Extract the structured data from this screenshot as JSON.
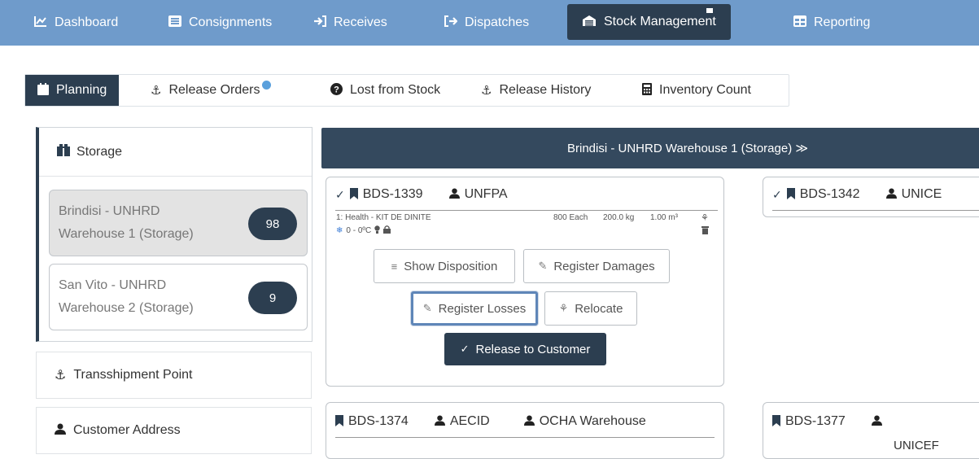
{
  "nav": {
    "items": [
      {
        "icon": "chart-line-icon",
        "glyph": "📈",
        "label": "Dashboard"
      },
      {
        "icon": "list-alt-icon",
        "glyph": "▤",
        "label": "Consignments"
      },
      {
        "icon": "sign-in-icon",
        "glyph": "➔",
        "label": "Receives"
      },
      {
        "icon": "sign-out-icon",
        "glyph": "➔",
        "label": "Dispatches"
      },
      {
        "icon": "warehouse-icon",
        "glyph": "⌂",
        "label": "Stock Management"
      },
      {
        "icon": "table-icon",
        "glyph": "▦",
        "label": "Reporting"
      }
    ]
  },
  "subtabs": {
    "planning": "Planning",
    "release_orders": "Release Orders",
    "lost_from_stock": "Lost from Stock",
    "release_history": "Release History",
    "inventory_count": "Inventory Count"
  },
  "left": {
    "storage_label": "Storage",
    "locations": [
      {
        "name": "Brindisi - UNHRD Warehouse 1 (Storage)",
        "count": "98"
      },
      {
        "name": "San Vito - UNHRD Warehouse 2 (Storage)",
        "count": "9"
      }
    ],
    "transshipment": "Transshipment Point",
    "customer_address": "Customer Address"
  },
  "warehouse_header": "Brindisi - UNHRD Warehouse 1 (Storage) ≫",
  "cards": {
    "c1": {
      "id": "BDS-1339",
      "org": "UNFPA",
      "item": "1: Health - KIT DE DINITE",
      "qty": "800 Each",
      "weight": "200.0 kg",
      "volume": "1.00 m³",
      "temp": "0 - 0ºC",
      "btn_show": "Show Disposition",
      "btn_damages": "Register Damages",
      "btn_losses": "Register Losses",
      "btn_relocate": "Relocate",
      "btn_release": "Release to Customer"
    },
    "c2": {
      "id": "BDS-1342",
      "org": "UNICE"
    },
    "c3": {
      "id": "BDS-1374",
      "org": "AECID",
      "dest": "OCHA Warehouse"
    },
    "c4": {
      "id": "BDS-1377",
      "org": "UNICEF"
    }
  },
  "colors": {
    "nav": "#6f9bcb",
    "dark": "#2c3e50",
    "header": "#34495e"
  }
}
